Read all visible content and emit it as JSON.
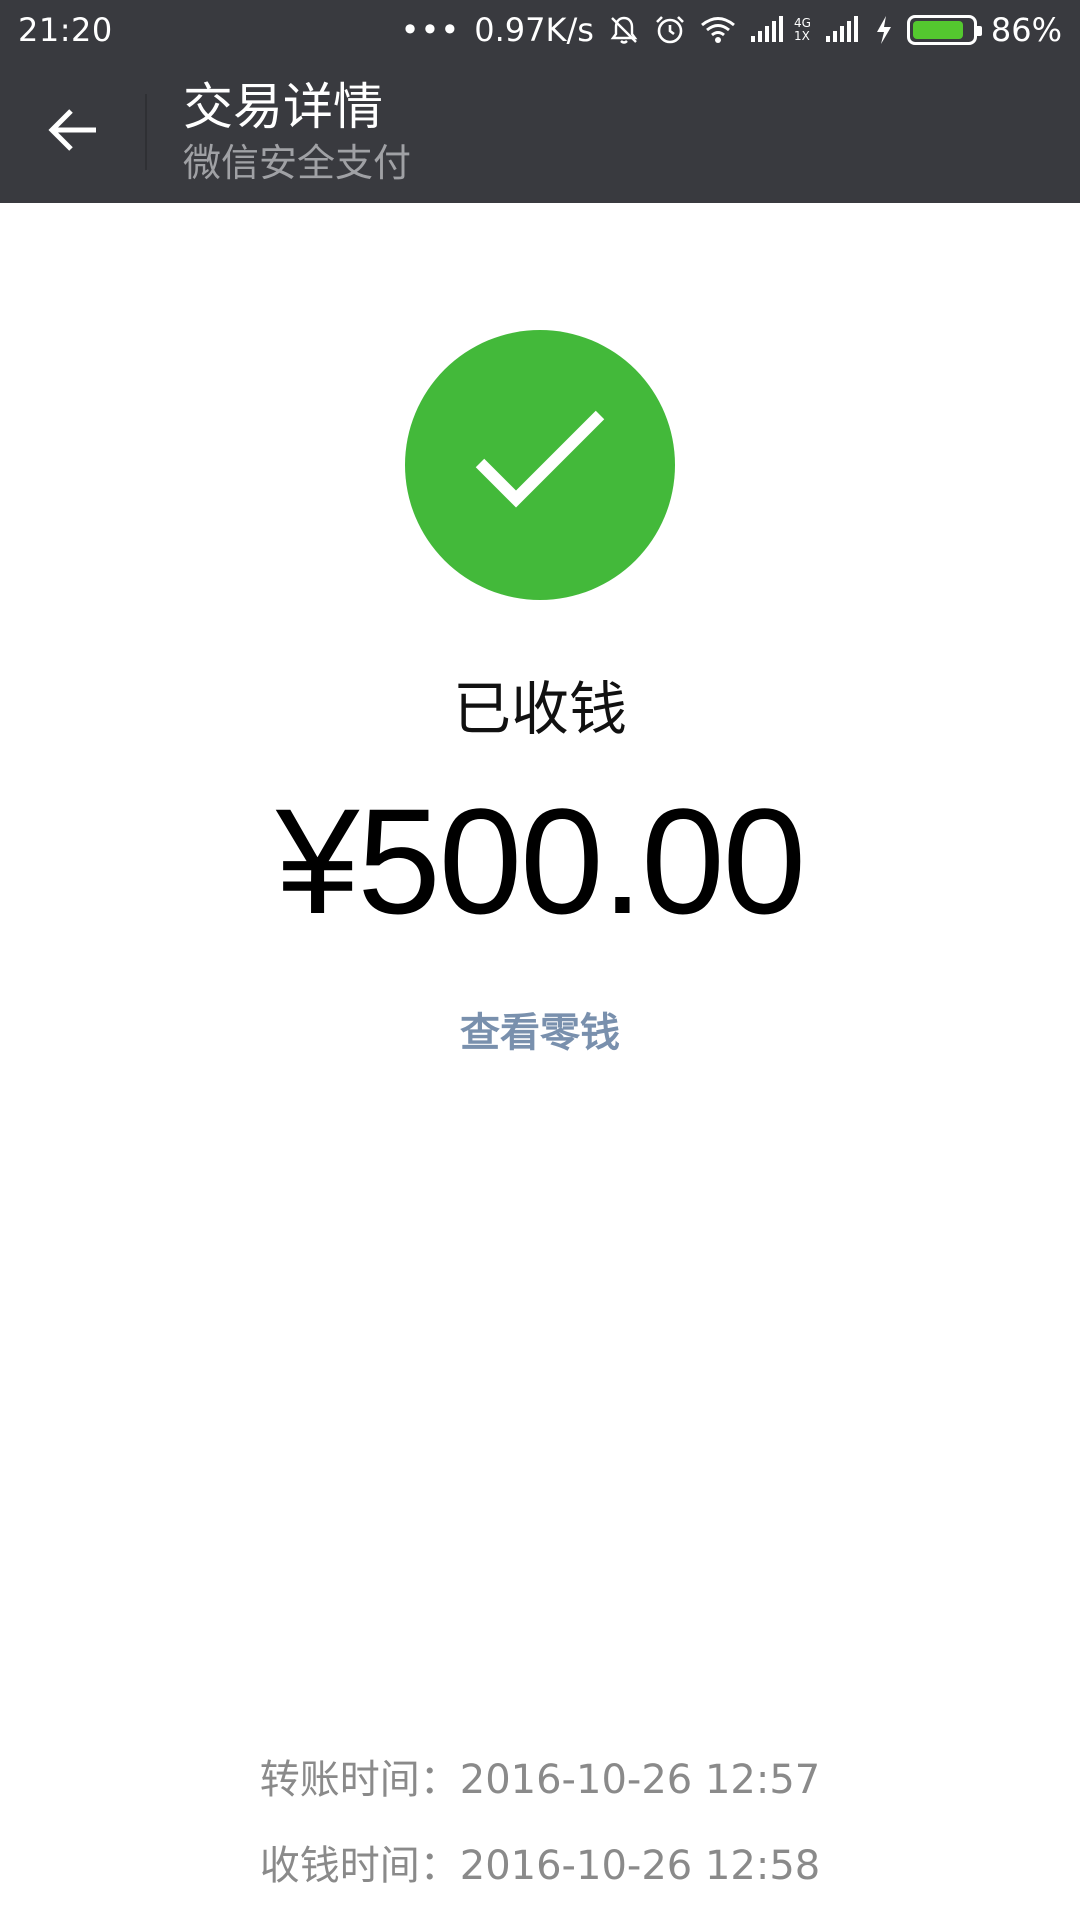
{
  "status_bar": {
    "time": "21:20",
    "dots": "•••",
    "network_speed": "0.97K/s",
    "net_type_top": "4G",
    "net_type_bottom": "1X",
    "battery_percent": "86%",
    "battery_level": 0.86,
    "battery_color": "#54c82f",
    "icons": [
      "mute-icon",
      "alarm-icon",
      "wifi-icon",
      "signal-icon",
      "signal-icon",
      "charging-icon",
      "battery-icon"
    ]
  },
  "header": {
    "title": "交易详情",
    "subtitle": "微信安全支付",
    "back_icon": "arrow-left-icon",
    "background": "#393a3f"
  },
  "main": {
    "status_icon": "checkmark-icon",
    "status_color": "#43b93a",
    "status_label": "已收钱",
    "amount": "¥500.00",
    "link_label": "查看零钱",
    "link_color": "#7990ad"
  },
  "times": {
    "transfer": "转账时间：2016-10-26 12:57",
    "received": "收钱时间：2016-10-26 12:58"
  }
}
